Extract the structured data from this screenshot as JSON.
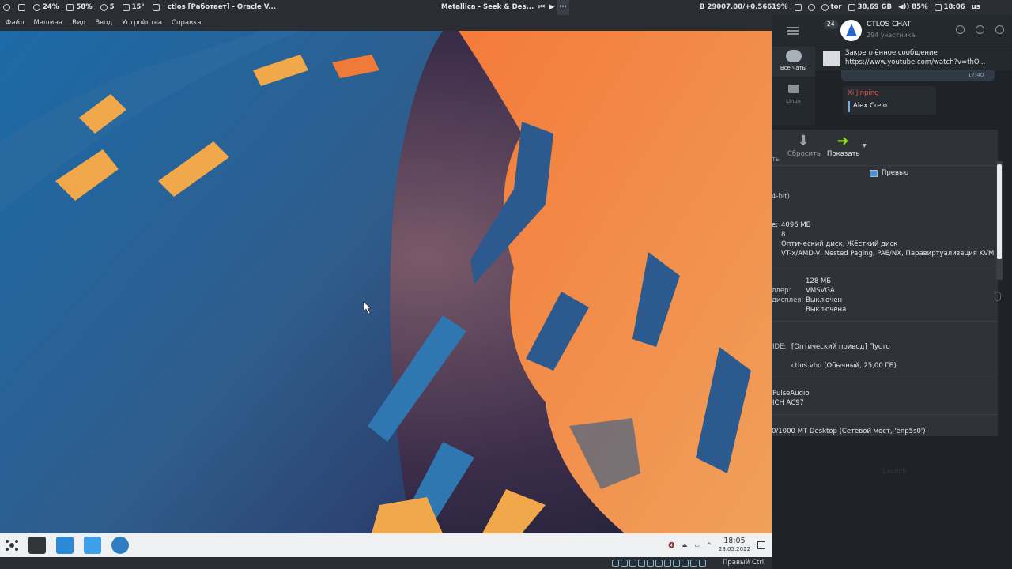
{
  "topbar": {
    "left_items": [
      {
        "icon": "monitor-icon",
        "text": ""
      },
      {
        "icon": "cpu-icon",
        "text": "24%"
      },
      {
        "icon": "memory-icon",
        "text": "58%"
      },
      {
        "icon": "updates-icon",
        "text": "5"
      },
      {
        "icon": "temperature-icon",
        "text": "15°"
      },
      {
        "icon": "mail-icon",
        "text": ""
      }
    ],
    "window_title": "ctlos [Работает] - Oracle V...",
    "media_title": "Metallica - Seek & Des...",
    "dots": "···",
    "right_items": [
      {
        "icon": "bitcoin-icon",
        "text": "B 29007.00/+0.56619%"
      },
      {
        "icon": "toggle-icon",
        "text": ""
      },
      {
        "icon": "vpn-icon",
        "text": ""
      },
      {
        "icon": "shield-icon",
        "text": ""
      },
      {
        "icon": "tor-icon",
        "text": "tor"
      },
      {
        "icon": "disk-icon",
        "text": "38,69 GB"
      },
      {
        "icon": "volume-icon",
        "text": "85%"
      },
      {
        "icon": "screen-icon",
        "text": "18:06"
      },
      {
        "icon": "keyboard-icon",
        "text": "us"
      }
    ]
  },
  "vm": {
    "menu": [
      "Файл",
      "Машина",
      "Вид",
      "Ввод",
      "Устройства",
      "Справка"
    ],
    "taskbar": {
      "time": "18:05",
      "date": "28.05.2022"
    },
    "status_host_key": "Правый Ctrl"
  },
  "telegram": {
    "badge": "24",
    "all_chats": "Все чаты",
    "folder_linux": "Linux",
    "chat_title": "CTLOS CHAT",
    "chat_members": "294 участника",
    "pinned_title": "Закреплённое сообщение",
    "pinned_url": "https://www.youtube.com/watch?v=thO...",
    "msg_time": "17:40",
    "msg2_name": "Xi Jinping",
    "msg2_text": "Alex Creio"
  },
  "vbox": {
    "cut_label": "ть",
    "reset_label": "Сбросить",
    "show_label": "Показать",
    "preview_label": "Превью",
    "arch": "4-bit)",
    "rows": [
      {
        "label": "",
        "value": "4096 МБ"
      },
      {
        "label": "",
        "value": "8"
      },
      {
        "label": "",
        "value": "Оптический диск, Жёсткий диск"
      },
      {
        "label": "",
        "value": "VT-x/AMD-V, Nested Paging, PAE/NX, Паравиртуализация KVM"
      }
    ],
    "display_rows": [
      {
        "label": "",
        "value": "128 МБ"
      },
      {
        "label": "ллер:",
        "value": "VMSVGA"
      },
      {
        "label": "дисплея:",
        "value": "Выключен"
      },
      {
        "label": "",
        "value": "Выключена"
      }
    ],
    "ide_label": "IDE:",
    "ide_value": "[Оптический привод] Пусто",
    "disk_value": "ctlos.vhd (Обычный, 25,00 ГБ)",
    "audio_driver": "PulseAudio",
    "audio_ctrl": "ICH AC97",
    "network": "0/1000 MT Desktop (Сетевой мост, 'enp5s0')",
    "sidebar_dim": "Launch"
  }
}
